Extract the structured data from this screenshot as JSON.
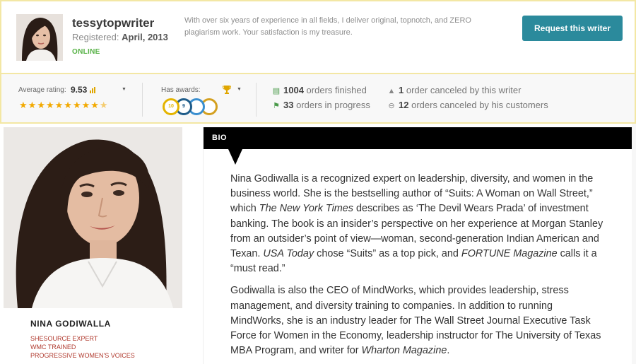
{
  "writer": {
    "username": "tessytopwriter",
    "registered_label": "Registered:",
    "registered_date": "April, 2013",
    "status": "ONLINE",
    "tagline": "With over six years of experience in all fields, I deliver original, topnotch, and ZERO plagiarism work. Your satisfaction is my treasure.",
    "request_button": "Request this writer"
  },
  "stats": {
    "rating_label": "Average rating:",
    "rating_value": "9.53",
    "stars_filled": 9.5,
    "stars_total": 10,
    "awards_label": "Has awards:",
    "badges": [
      {
        "name": "10 triple",
        "label": "10",
        "color": "#e4b400"
      },
      {
        "name": "9 plus",
        "label": "9",
        "color": "#1f5c8a"
      },
      {
        "name": "blue award",
        "label": "",
        "color": "#3a8fd0"
      },
      {
        "name": "gold award",
        "label": "",
        "color": "#d4a020"
      }
    ],
    "orders_finished_count": "1004",
    "orders_finished_text": "orders finished",
    "orders_in_progress_count": "33",
    "orders_in_progress_text": "orders in progress",
    "canceled_by_writer_count": "1",
    "canceled_by_writer_text": "order canceled by this writer",
    "canceled_by_customers_count": "12",
    "canceled_by_customers_text": "orders canceled by his customers",
    "accent_green": "#4a9a4a",
    "accent_gray": "#888888"
  },
  "profile": {
    "name": "NINA GODIWALLA",
    "credentials": [
      "SHESOURCE EXPERT",
      "WMC TRAINED",
      "PROGRESSIVE WOMEN'S VOICES"
    ]
  },
  "bio": {
    "title": "BIO",
    "p1_a": "Nina Godiwalla is a recognized expert on leadership, diversity, and women in the business world. She is the bestselling author of “Suits: A Woman on Wall Street,” which ",
    "p1_i1": "The New York Times",
    "p1_b": " describes as ‘The Devil Wears Prada’ of investment banking. The book is an insider’s perspective on her experience at Morgan Stanley from an outsider’s point of view—woman, second-generation Indian American and Texan. ",
    "p1_i2": "USA Today",
    "p1_c": " chose “Suits” as a top pick, and ",
    "p1_i3": "FORTUNE Magazine",
    "p1_d": " calls it a “must read.”",
    "p2_a": "Godiwalla is also the CEO of MindWorks, which provides leadership, stress management, and diversity training to companies. In addition to running MindWorks, she is an industry leader for The Wall Street Journal Executive Task Force for Women in the Economy, leadership instructor for The University of Texas MBA Program, and writer for ",
    "p2_i1": "Wharton Magazine",
    "p2_b": "."
  },
  "colors": {
    "button_teal": "#2b8a9c",
    "card_border": "#f3e7a4",
    "star_gold": "#f2a900",
    "online_green": "#55b144",
    "credential_red": "#b03a2e"
  }
}
